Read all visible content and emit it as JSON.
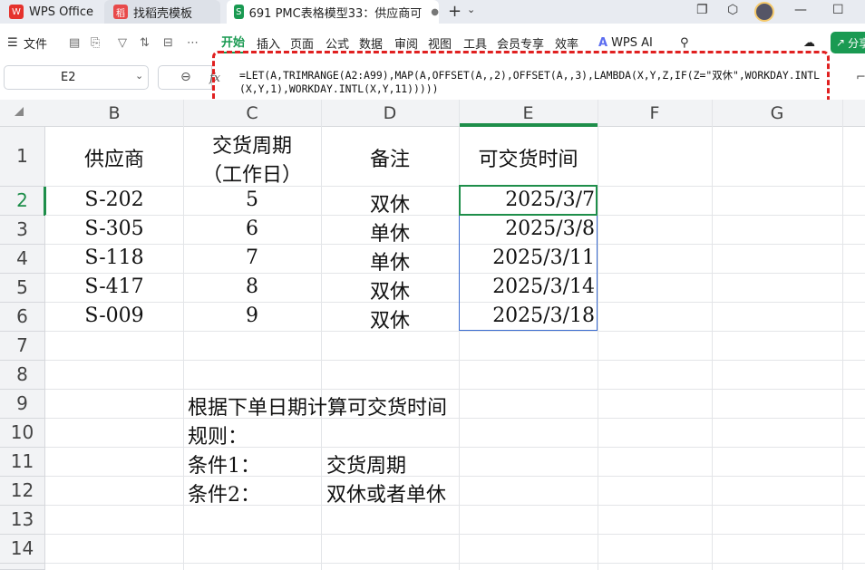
{
  "titlebar": {
    "tabs": [
      {
        "icon": "wps-logo-icon",
        "label": "WPS Office"
      },
      {
        "icon": "daoke-logo-icon",
        "label": "找稻壳模板"
      },
      {
        "icon": "spreadsheet-icon",
        "label": "691 PMC表格模型33：供应商可"
      }
    ]
  },
  "ribbon": {
    "file_label": "文件",
    "tabs": [
      "开始",
      "插入",
      "页面",
      "公式",
      "数据",
      "审阅",
      "视图",
      "工具",
      "会员专享",
      "效率"
    ],
    "active_tab": "开始",
    "wps_ai_label": "WPS AI",
    "share_label": "分享"
  },
  "formula_bar": {
    "cell_ref": "E2",
    "fx_symbol": "fx",
    "formula": "=LET(A,TRIMRANGE(A2:A99),MAP(A,OFFSET(A,,2),OFFSET(A,,3),LAMBDA(X,Y,Z,IF(Z=\"双休\",WORKDAY.INTL(X,Y,1),WORKDAY.INTL(X,Y,11)))))",
    "collapse_glyph": "⌃"
  },
  "columns": [
    "B",
    "C",
    "D",
    "E",
    "F",
    "G"
  ],
  "rows": [
    "1",
    "2",
    "3",
    "4",
    "5",
    "6",
    "7",
    "8",
    "9",
    "10",
    "11",
    "12",
    "13",
    "14"
  ],
  "table": {
    "headers": {
      "supplier": "供应商",
      "cycle_line1": "交货周期",
      "cycle_line2": "（工作日）",
      "note": "备注",
      "deliver": "可交货时间"
    },
    "records": [
      {
        "supplier": "S-202",
        "cycle": "5",
        "note": "双休",
        "deliver": "2025/3/7"
      },
      {
        "supplier": "S-305",
        "cycle": "6",
        "note": "单休",
        "deliver": "2025/3/8"
      },
      {
        "supplier": "S-118",
        "cycle": "7",
        "note": "单休",
        "deliver": "2025/3/11"
      },
      {
        "supplier": "S-417",
        "cycle": "8",
        "note": "双休",
        "deliver": "2025/3/14"
      },
      {
        "supplier": "S-009",
        "cycle": "9",
        "note": "双休",
        "deliver": "2025/3/18"
      }
    ]
  },
  "notes": {
    "title": "根据下单日期计算可交货时间",
    "rules": "规则：",
    "cond1_label": "条件1：",
    "cond1_value": "交货周期",
    "cond2_label": "条件2：",
    "cond2_value": "双休或者单休"
  },
  "colors": {
    "accent": "#1a9a52",
    "selection": "#1e8e4a",
    "range": "#3a6bd0",
    "highlight": "#e02020"
  }
}
